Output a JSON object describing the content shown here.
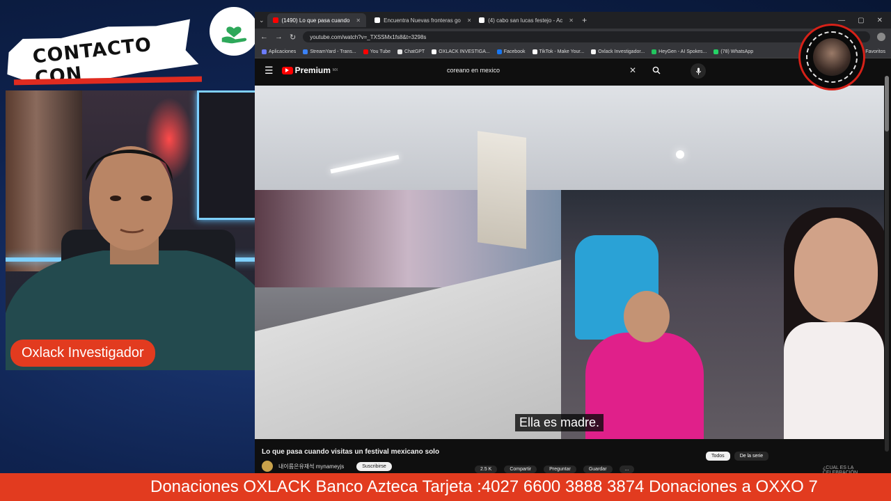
{
  "brand": {
    "banner_text": "CONTACTO CON",
    "accent": "#e23b1f"
  },
  "webcam": {
    "name_tag": "Oxlack Investigador"
  },
  "browser": {
    "tabs": [
      {
        "label": "(1490) Lo que pasa cuando",
        "active": true,
        "icon": "youtube-icon",
        "color": "#ff0000"
      },
      {
        "label": "Encuentra Nuevas fronteras go",
        "active": false,
        "icon": "tiktok-icon",
        "color": "#ffffff"
      },
      {
        "label": "(4) cabo san lucas festejo - Ac",
        "active": false,
        "icon": "x-icon",
        "color": "#ffffff"
      }
    ],
    "url": "youtube.com/watch?v=_TXSSMx1fs8&t=3298s",
    "bookmarks": [
      {
        "label": "Aplicaciones",
        "color": "#6b7cff"
      },
      {
        "label": "StreamYard - Trans...",
        "color": "#3b82f6"
      },
      {
        "label": "You Tube",
        "color": "#ff0000"
      },
      {
        "label": "ChatGPT",
        "color": "#e5e5e5"
      },
      {
        "label": "OXLACK INVESTIGA...",
        "color": "#ffffff"
      },
      {
        "label": "Facebook",
        "color": "#1877f2"
      },
      {
        "label": "TikTok - Make Your...",
        "color": "#ffffff"
      },
      {
        "label": "Oxlack Investigador...",
        "color": "#f5f5f5"
      },
      {
        "label": "HeyGen - AI Spokes...",
        "color": "#22c55e"
      },
      {
        "label": "(78) WhatsApp",
        "color": "#25d366"
      }
    ],
    "bookmarks_right": "Favoritos"
  },
  "youtube": {
    "logo_text": "Premium",
    "logo_sup": "MX",
    "search_query": "coreano en mexico",
    "subtitle": "Ella es madre.",
    "video_title": "Lo que pasa cuando visitas un festival mexicano solo",
    "channel": "내이름은유재석 mynameyjs",
    "subscribe": "Suscribirse",
    "actions": [
      "2.5 K",
      "Compartir",
      "Preguntar",
      "Guardar",
      "..."
    ],
    "filters": [
      {
        "label": "Todos",
        "active": true
      },
      {
        "label": "De la serie",
        "active": false
      }
    ],
    "side_text": "¿CUAL ES LA CELEBRACIÓN..."
  },
  "ticker": {
    "text": "Donaciones OXLACK Banco Azteca Tarjeta :4027 6600 3888 3874 Donaciones a OXXO 7"
  }
}
